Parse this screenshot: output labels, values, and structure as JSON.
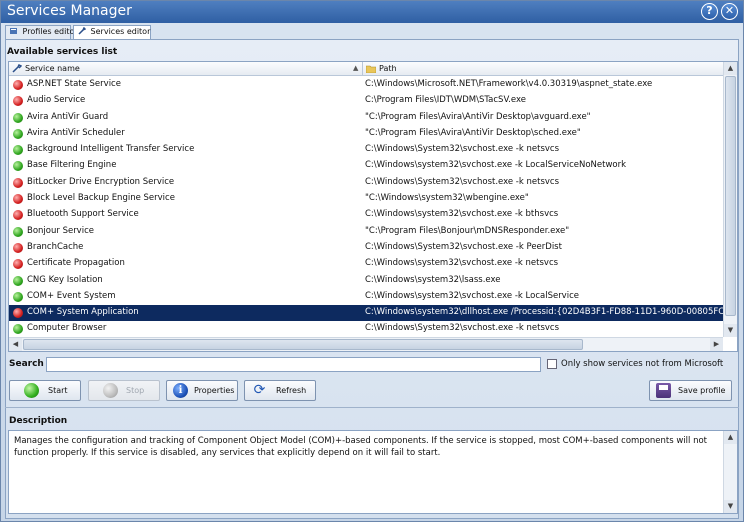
{
  "window": {
    "title": "Services Manager"
  },
  "tabs": [
    {
      "label": "Profiles editor"
    },
    {
      "label": "Services editor"
    }
  ],
  "services_section": {
    "label": "Available services list",
    "columns": {
      "name": "Service name",
      "path": "Path"
    },
    "rows": [
      {
        "status": "red",
        "name": "ASP.NET State Service",
        "path": "C:\\Windows\\Microsoft.NET\\Framework\\v4.0.30319\\aspnet_state.exe"
      },
      {
        "status": "red",
        "name": "Audio Service",
        "path": "C:\\Program Files\\IDT\\WDM\\STacSV.exe"
      },
      {
        "status": "green",
        "name": "Avira AntiVir Guard",
        "path": "\"C:\\Program Files\\Avira\\AntiVir Desktop\\avguard.exe\""
      },
      {
        "status": "green",
        "name": "Avira AntiVir Scheduler",
        "path": "\"C:\\Program Files\\Avira\\AntiVir Desktop\\sched.exe\""
      },
      {
        "status": "green",
        "name": "Background Intelligent Transfer Service",
        "path": "C:\\Windows\\System32\\svchost.exe -k netsvcs"
      },
      {
        "status": "green",
        "name": "Base Filtering Engine",
        "path": "C:\\Windows\\system32\\svchost.exe -k LocalServiceNoNetwork"
      },
      {
        "status": "red",
        "name": "BitLocker Drive Encryption Service",
        "path": "C:\\Windows\\System32\\svchost.exe -k netsvcs"
      },
      {
        "status": "red",
        "name": "Block Level Backup Engine Service",
        "path": "\"C:\\Windows\\system32\\wbengine.exe\""
      },
      {
        "status": "red",
        "name": "Bluetooth Support Service",
        "path": "C:\\Windows\\system32\\svchost.exe -k bthsvcs"
      },
      {
        "status": "green",
        "name": "Bonjour Service",
        "path": "\"C:\\Program Files\\Bonjour\\mDNSResponder.exe\""
      },
      {
        "status": "red",
        "name": "BranchCache",
        "path": "C:\\Windows\\System32\\svchost.exe -k PeerDist"
      },
      {
        "status": "red",
        "name": "Certificate Propagation",
        "path": "C:\\Windows\\system32\\svchost.exe -k netsvcs"
      },
      {
        "status": "green",
        "name": "CNG Key Isolation",
        "path": "C:\\Windows\\system32\\lsass.exe"
      },
      {
        "status": "green",
        "name": "COM+ Event System",
        "path": "C:\\Windows\\system32\\svchost.exe -k LocalService"
      },
      {
        "status": "red",
        "name": "COM+ System Application",
        "path": "C:\\Windows\\system32\\dllhost.exe /Processid:{02D4B3F1-FD88-11D1-960D-00805FC",
        "selected": true
      },
      {
        "status": "green",
        "name": "Computer Browser",
        "path": "C:\\Windows\\System32\\svchost.exe -k netsvcs"
      }
    ]
  },
  "search": {
    "label": "Search",
    "value": "",
    "only_non_ms_label": "Only show services not from Microsoft",
    "only_non_ms_checked": false
  },
  "buttons": {
    "start": "Start",
    "stop": "Stop",
    "properties": "Properties",
    "refresh": "Refresh",
    "save_profile": "Save profile"
  },
  "description": {
    "label": "Description",
    "text": "Manages the configuration and tracking of Component Object Model (COM)+-based components. If the service is stopped, most COM+-based components will not function properly. If this service is disabled, any services that explicitly depend on it will fail to start."
  },
  "icons": {
    "running": "green-status-dot-icon",
    "stopped": "red-status-dot-icon",
    "help": "help-icon",
    "close": "close-icon"
  },
  "colors": {
    "selected_row": "#0d2a5f",
    "running": "#2fa51e",
    "stopped": "#d42020",
    "titlebar": "#3a6cb0"
  }
}
